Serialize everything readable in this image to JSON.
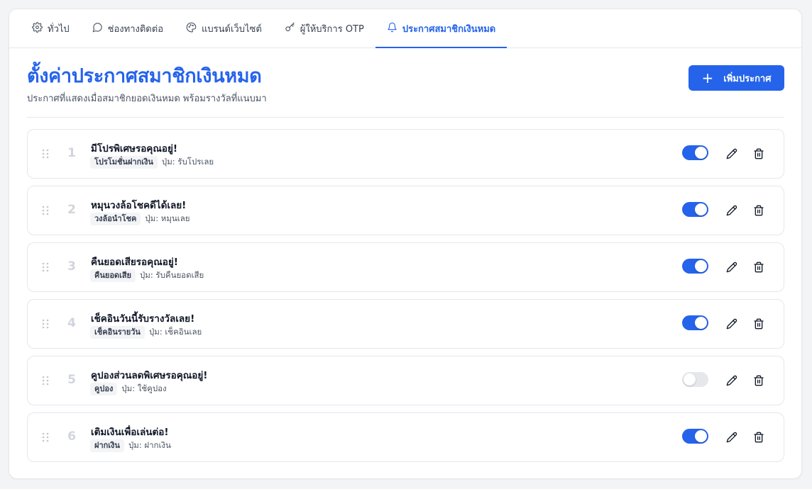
{
  "tabs": [
    {
      "label": "ทั่วไป",
      "icon": "gear-icon",
      "active": false
    },
    {
      "label": "ช่องทางติดต่อ",
      "icon": "chat-bubble-icon",
      "active": false
    },
    {
      "label": "แบรนด์เว็บไซต์",
      "icon": "palette-icon",
      "active": false
    },
    {
      "label": "ผู้ให้บริการ OTP",
      "icon": "key-icon",
      "active": false
    },
    {
      "label": "ประกาศสมาชิกเงินหมด",
      "icon": "bell-icon",
      "active": true
    }
  ],
  "page": {
    "title": "ตั้งค่าประกาศสมาชิกเงินหมด",
    "subtitle": "ประกาศที่แสดงเมื่อสมาชิกยอดเงินหมด พร้อมรางวัลที่แนบมา",
    "add_button": "เพิ่มประกาศ"
  },
  "colors": {
    "accent": "#2563eb",
    "toggle_off": "#e5e7eb"
  },
  "announcements": [
    {
      "number": "1",
      "message": "มีโปรพิเศษรอคุณอยู่!",
      "tag": "โปรโมชั่นฝากเงิน",
      "button_label": "ปุ่ม: รับโปรเลย",
      "enabled": true
    },
    {
      "number": "2",
      "message": "หมุนวงล้อโชคดีได้เลย!",
      "tag": "วงล้อนำโชค",
      "button_label": "ปุ่ม: หมุนเลย",
      "enabled": true
    },
    {
      "number": "3",
      "message": "คืนยอดเสียรอคุณอยู่!",
      "tag": "คืนยอดเสีย",
      "button_label": "ปุ่ม: รับคืนยอดเสีย",
      "enabled": true
    },
    {
      "number": "4",
      "message": "เช็คอินวันนี้รับรางวัลเลย!",
      "tag": "เช็คอินรายวัน",
      "button_label": "ปุ่ม: เช็คอินเลย",
      "enabled": true
    },
    {
      "number": "5",
      "message": "คูปองส่วนลดพิเศษรอคุณอยู่!",
      "tag": "คูปอง",
      "button_label": "ปุ่ม: ใช้คูปอง",
      "enabled": false
    },
    {
      "number": "6",
      "message": "เติมเงินเพื่อเล่นต่อ!",
      "tag": "ฝากเงิน",
      "button_label": "ปุ่ม: ฝากเงิน",
      "enabled": true
    }
  ]
}
